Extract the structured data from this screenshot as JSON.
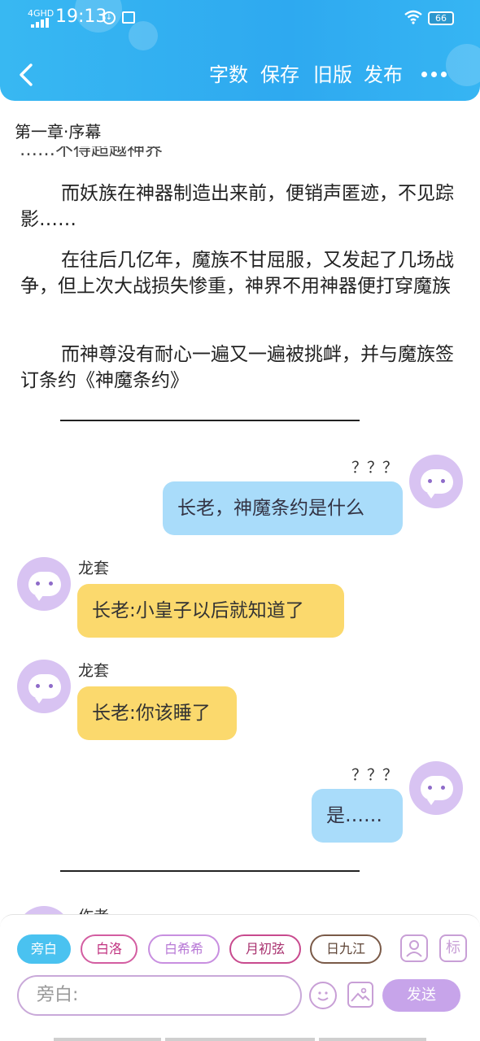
{
  "status_bar": {
    "network": "4GHD",
    "time": "19:13",
    "battery": "66"
  },
  "header": {
    "actions": [
      "字数",
      "保存",
      "旧版",
      "发布"
    ]
  },
  "chapter_title": "第一章·序幕",
  "cut_line_text": "……不得超越神界",
  "paragraphs": [
    "而妖族在神器制造出来前，便销声匿迹，不见踪影……",
    "在往后几亿年，魔族不甘屈服，又发起了几场战争，但上次大战损失惨重，神界不用神器便打穿魔族",
    "而神尊没有耐心一遍又一遍被挑衅，并与魔族签订条约《神魔条约》"
  ],
  "messages": [
    {
      "name": "？？？",
      "text": "长老，神魔条约是什么",
      "side": "right",
      "color": "#a9dcfa"
    },
    {
      "name": "龙套",
      "text": "长老:小皇子以后就知道了",
      "side": "left",
      "color": "#fbd96d"
    },
    {
      "name": "龙套",
      "text": "长老:你该睡了",
      "side": "left",
      "color": "#fbd96d"
    },
    {
      "name": "？？？",
      "text": "是……",
      "side": "right",
      "color": "#a9dcfa"
    }
  ],
  "partial_name": "作者",
  "roles": [
    {
      "label": "旁白",
      "selected": true
    },
    {
      "label": "白洛",
      "selected": false
    },
    {
      "label": "白希希",
      "selected": false
    },
    {
      "label": "月初弦",
      "selected": false
    },
    {
      "label": "日九江",
      "selected": false
    }
  ],
  "role_actions": {
    "tag_label": "标"
  },
  "input": {
    "placeholder": "旁白:"
  },
  "send_label": "发送",
  "colors": {
    "header": "#2ea9f0",
    "accent_purple": "#c7a4ea",
    "bubble_blue": "#a9dcfa",
    "bubble_yellow": "#fbd96d",
    "selected_chip": "#4ac2f0"
  }
}
